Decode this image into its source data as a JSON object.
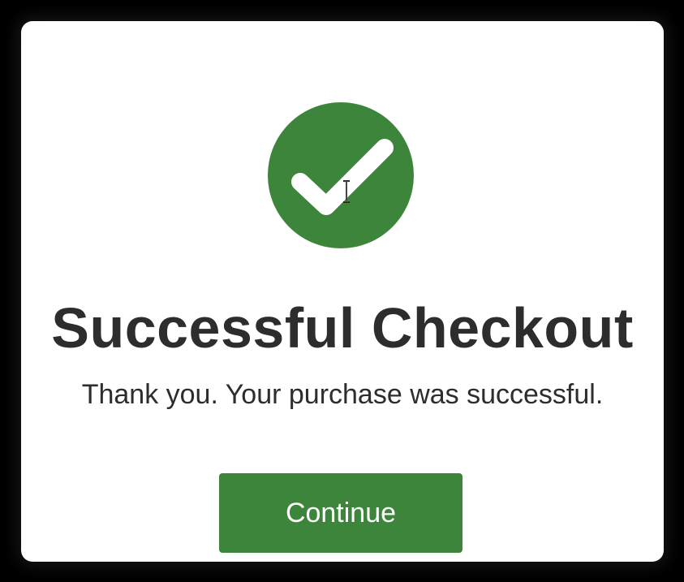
{
  "dialog": {
    "icon": "checkmark-circle-icon",
    "title": "Successful Checkout",
    "message": "Thank you. Your purchase was successful.",
    "continue_label": "Continue"
  },
  "colors": {
    "accent": "#3d853a",
    "text": "#2d2d2d",
    "background": "#ffffff",
    "backdrop": "#000000"
  },
  "cursor": {
    "type": "text-cursor-icon"
  }
}
